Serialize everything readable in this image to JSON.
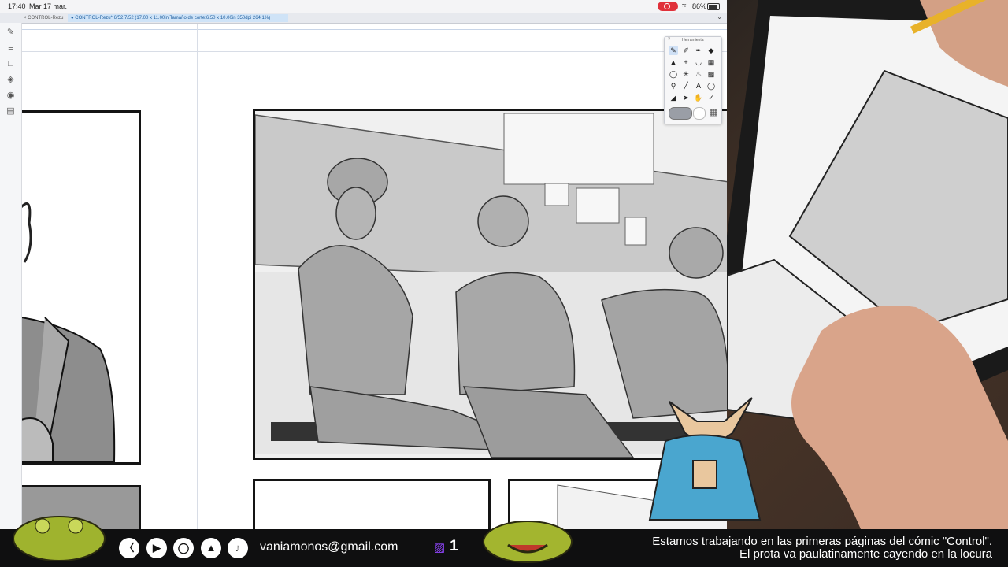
{
  "status_bar": {
    "time": "17:40",
    "date": "Mar 17 mar.",
    "battery": "86%"
  },
  "tabs": [
    {
      "label": "CONTROL-Rezu"
    },
    {
      "label": "CONTROL-Rezu* 6/52,7/52 (17.00 x 11.00in Tamaño de corte:6.50 x 10.00in 350dpi 264.1%)"
    }
  ],
  "tool_palette": {
    "title": "Herramienta",
    "tools": [
      "pen-icon",
      "pencil-icon",
      "brush-icon",
      "eraser-icon",
      "move-icon",
      "plus-icon",
      "fill-icon",
      "grid-icon",
      "lasso-icon",
      "wand-icon",
      "bucket-icon",
      "gradient-icon",
      "zoom-icon",
      "line-icon",
      "text-icon",
      "balloon-icon",
      "ruler-icon",
      "select-icon",
      "hand-icon",
      "eyedropper-icon"
    ],
    "colors": {
      "main": "#9a9ea6",
      "sub": "#ffffff"
    }
  },
  "footer": {
    "social_icons": [
      "twitch-icon",
      "youtube-icon",
      "instagram-icon",
      "artstation-icon",
      "tiktok-icon"
    ],
    "email": "vaniamonos@gmail.com",
    "viewer_count": "1",
    "description": "Estamos trabajando en las primeras páginas del cómic \"Control\". El prota va paulatinamente cayendo en la locura"
  },
  "colors": {
    "twitch": "#9146ff",
    "footer_bg": "#0f0f10",
    "frog": "#9fb32e"
  }
}
